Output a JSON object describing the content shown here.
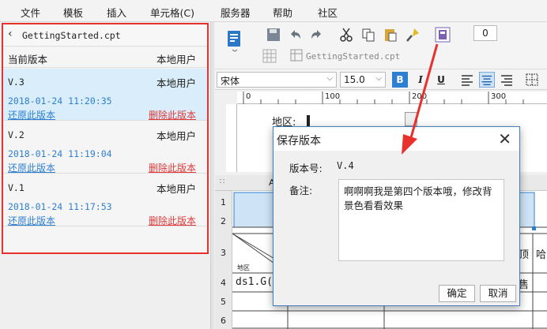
{
  "menu": [
    "文件",
    "模板",
    "插入",
    "单元格(C)",
    "服务器",
    "帮助",
    "社区"
  ],
  "version_panel": {
    "back_icon": "chevron-left-icon",
    "file_name": "GettingStarted.cpt",
    "header_version": "当前版本",
    "header_user": "本地用户",
    "versions": [
      {
        "version": "V.3",
        "user": "本地用户",
        "timestamp": "2018-01-24 11:20:35",
        "restore": "还原此版本",
        "delete": "删除此版本",
        "selected": true
      },
      {
        "version": "V.2",
        "user": "本地用户",
        "timestamp": "2018-01-24 11:19:04",
        "restore": "还原此版本",
        "delete": "删除此版本",
        "selected": false
      },
      {
        "version": "V.1",
        "user": "本地用户",
        "timestamp": "2018-01-24 11:17:53",
        "restore": "还原此版本",
        "delete": "删除此版本",
        "selected": false
      }
    ]
  },
  "toolbar": {
    "template_tab": "GettingStarted.cpt",
    "counter": "0"
  },
  "font_bar": {
    "font": "宋体",
    "size": "15.0",
    "bold": "B",
    "italic": "I",
    "underline": "U"
  },
  "ruler": {
    "ticks": [
      "100",
      "200",
      "300"
    ]
  },
  "canvas": {
    "param_label": "地区:"
  },
  "grid": {
    "col_header": "A",
    "row_numbers": [
      "1",
      "2",
      "3",
      "4",
      "5",
      "6"
    ],
    "cells": {
      "small_label": "地区",
      "formula": "ds1.G(",
      "right_1": "顶",
      "right_2": "哈",
      "right_3": "售"
    }
  },
  "dialog": {
    "title": "保存版本",
    "version_label": "版本号:",
    "version_value": "V.4",
    "note_label": "备注:",
    "note_text": "啊啊啊我是第四个版本哦，修改背景色看看效果",
    "confirm": "确定",
    "cancel": "取消"
  },
  "colors": {
    "highlight_red": "#e8302c",
    "selected_row": "#d9eefa",
    "link_blue": "#2f7fd0",
    "delete_red": "#e03a3a"
  }
}
